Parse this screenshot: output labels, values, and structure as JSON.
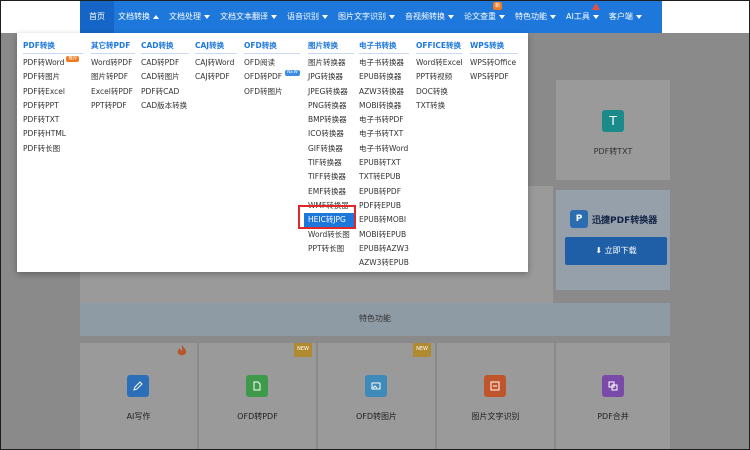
{
  "nav": {
    "items": [
      {
        "label": "首页"
      },
      {
        "label": "文档转换"
      },
      {
        "label": "文档处理"
      },
      {
        "label": "文档文本翻译"
      },
      {
        "label": "语音识别"
      },
      {
        "label": "图片文字识别"
      },
      {
        "label": "音视频转换"
      },
      {
        "label": "论文查重"
      },
      {
        "label": "特色功能"
      },
      {
        "label": "AI工具"
      },
      {
        "label": "客户端"
      }
    ],
    "new_badge": "新"
  },
  "dropdown": {
    "columns": [
      {
        "title": "PDF转换",
        "items": [
          "PDF转Word",
          "PDF转图片",
          "PDF转Excel",
          "PDF转PPT",
          "PDF转TXT",
          "PDF转HTML",
          "PDF转长图"
        ],
        "hot_tag": "推荐"
      },
      {
        "title": "其它转PDF",
        "items": [
          "Word转PDF",
          "图片转PDF",
          "Excel转PDF",
          "PPT转PDF"
        ]
      },
      {
        "title": "CAD转换",
        "items": [
          "CAD转PDF",
          "CAD转图片",
          "PDF转CAD",
          "CAD版本转换"
        ]
      },
      {
        "title": "CAJ转换",
        "items": [
          "CAJ转Word",
          "CAJ转PDF"
        ]
      },
      {
        "title": "OFD转换",
        "items": [
          "OFD阅读",
          "OFD转PDF",
          "OFD转图片"
        ],
        "new_tag": "NEW"
      },
      {
        "title": "图片转换",
        "items": [
          "图片转换器",
          "JPG转换器",
          "JPEG转换器",
          "PNG转换器",
          "BMP转换器",
          "ICO转换器",
          "GIF转换器",
          "TIF转换器",
          "TIFF转换器",
          "EMF转换器",
          "WMF转换器",
          "HEIC转JPG",
          "Word转长图",
          "PPT转长图"
        ]
      },
      {
        "title": "电子书转换",
        "items": [
          "电子书转换器",
          "EPUB转换器",
          "AZW3转换器",
          "MOBI转换器",
          "电子书转PDF",
          "电子书转TXT",
          "电子书转Word",
          "EPUB转TXT",
          "TXT转EPUB",
          "EPUB转PDF",
          "PDF转EPUB",
          "EPUB转MOBI",
          "MOBI转EPUB",
          "EPUB转AZW3",
          "AZW3转EPUB"
        ]
      },
      {
        "title": "OFFICE转换",
        "items": [
          "Word转Excel",
          "PPT转视频",
          "DOC转换",
          "TXT转换"
        ]
      },
      {
        "title": "WPS转换",
        "items": [
          "WPS转Office",
          "WPS转PDF"
        ]
      }
    ]
  },
  "background": {
    "pdf_txt_label": "PDF转TXT",
    "download_logo": "迅捷PDF转换器",
    "download_button": "立即下载",
    "section_title": "特色功能",
    "features": [
      {
        "label": "AI写作",
        "color": "#2a6fb8"
      },
      {
        "label": "OFD转PDF",
        "color": "#3e9a4a",
        "corner": "NEW"
      },
      {
        "label": "OFD转图片",
        "color": "#3e8ab8",
        "corner": "NEW"
      },
      {
        "label": "图片文字识别",
        "color": "#c0542a"
      },
      {
        "label": "PDF合并",
        "color": "#7a4aa8"
      }
    ]
  }
}
